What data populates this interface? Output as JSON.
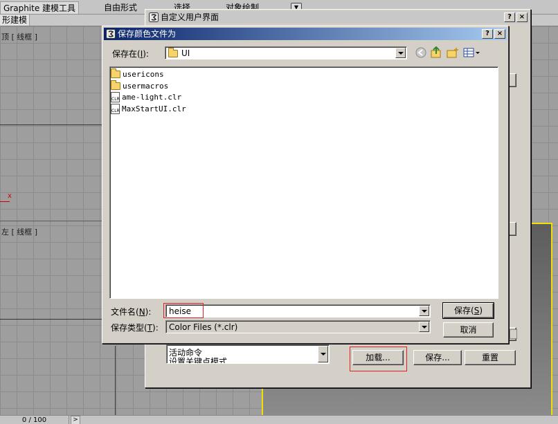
{
  "menubar": {
    "tabs": [
      "Graphite 建模工具",
      "自由形式",
      "选择",
      "对象绘制"
    ],
    "sub_tab": "形建模"
  },
  "viewports": {
    "top_label": "顶 [ 线框 ]",
    "left_label": "左 [ 线框 ]",
    "axis_label": "x"
  },
  "statusbar": {
    "progress": "0 / 100",
    "next": ">"
  },
  "custom_ui": {
    "title": "自定义用户界面",
    "help": "?",
    "close": "×",
    "list_items": [
      "活动命令",
      "设置关键点模式"
    ],
    "load_button": "加载...",
    "save_button": "保存...",
    "reset_button": "重置"
  },
  "save_dialog": {
    "title": "保存颜色文件为",
    "help": "?",
    "close": "×",
    "save_in_label": "保存在(",
    "save_in_key": "I",
    "save_in_label_end": "):",
    "save_in_value": "UI",
    "files": [
      {
        "name": "usericons",
        "type": "folder"
      },
      {
        "name": "usermacros",
        "type": "folder"
      },
      {
        "name": "ame-light.clr",
        "type": "clr"
      },
      {
        "name": "MaxStartUI.clr",
        "type": "clr"
      }
    ],
    "filename_label": "文件名(",
    "filename_key": "N",
    "filename_label_end": "):",
    "filename_value": "heise",
    "filetype_label": "保存类型(",
    "filetype_key": "T",
    "filetype_label_end": "):",
    "filetype_value": "Color Files (*.clr)",
    "save_btn": "保存(",
    "save_btn_key": "S",
    "save_btn_end": ")",
    "cancel_btn": "取消"
  },
  "colors": {
    "highlight": "#e02020",
    "active_viewport": "#f1e000",
    "title_active": "#0a246a"
  }
}
